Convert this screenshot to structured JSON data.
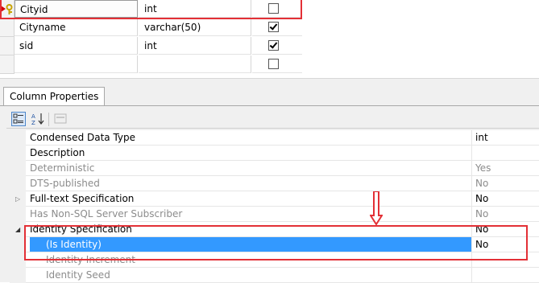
{
  "columns": [
    {
      "name": "Cityid",
      "type": "int",
      "allow_nulls": false,
      "primary_key": true
    },
    {
      "name": "Cityname",
      "type": "varchar(50)",
      "allow_nulls": true,
      "primary_key": false
    },
    {
      "name": "sid",
      "type": "int",
      "allow_nulls": true,
      "primary_key": false
    },
    {
      "name": "",
      "type": "",
      "allow_nulls": false,
      "primary_key": false
    }
  ],
  "panel": {
    "tab_label": "Column Properties",
    "toolbar": {
      "categorized_icon": "categorized-icon",
      "alphabetical_icon": "alphabetical-icon",
      "property-pages_icon": "property-pages-icon"
    },
    "properties": [
      {
        "name": "Condensed Data Type",
        "value": "int",
        "state": "bold"
      },
      {
        "name": "Description",
        "value": "",
        "state": "bold"
      },
      {
        "name": "Deterministic",
        "value": "Yes",
        "state": "disabled"
      },
      {
        "name": "DTS-published",
        "value": "No",
        "state": "disabled"
      },
      {
        "name": "Full-text Specification",
        "value": "No",
        "state": "bold",
        "expander": "▷"
      },
      {
        "name": "Has Non-SQL Server Subscriber",
        "value": "No",
        "state": "disabled"
      },
      {
        "name": "Identity Specification",
        "value": "No",
        "state": "bold",
        "expander": "◢"
      },
      {
        "name": "(Is Identity)",
        "value": "No",
        "state": "selected"
      },
      {
        "name": "Identity Increment",
        "value": "",
        "state": "disabled-sub"
      },
      {
        "name": "Identity Seed",
        "value": "",
        "state": "disabled-sub"
      }
    ]
  },
  "colors": {
    "highlight": "#e33036",
    "selection": "#3399ff"
  }
}
